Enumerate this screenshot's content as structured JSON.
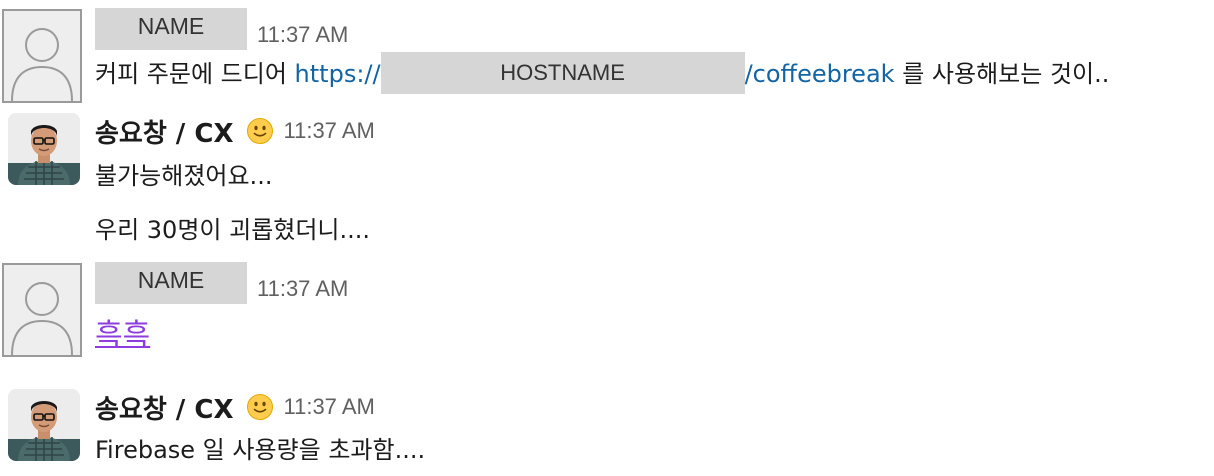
{
  "colors": {
    "link": "#1264a3",
    "mention": "#8e3ce0",
    "timestamp": "#616061",
    "redaction": "#d6d6d6"
  },
  "messages": [
    {
      "avatar": "default-user-icon",
      "sender": "NAME",
      "time": "11:37 AM",
      "text_before": "커피 주문에 드디어",
      "link_prefix": "https://",
      "link_host": "HOSTNAME",
      "link_path": "/coffeebreak",
      "text_after": "를 사용해보는 것이.."
    },
    {
      "avatar": "user-photo",
      "sender": "송요창 / CX",
      "status_emoji": "slightly-smiling-face-icon",
      "time": "11:37 AM",
      "lines": [
        "불가능해졌어요...",
        "우리 30명이 괴롭혔더니...."
      ]
    },
    {
      "avatar": "default-user-icon",
      "sender": "NAME",
      "time": "11:37 AM",
      "text": "흑흑"
    },
    {
      "avatar": "user-photo",
      "sender": "송요창 / CX",
      "status_emoji": "slightly-smiling-face-icon",
      "time": "11:37 AM",
      "text": "Firebase 일 사용량을 초과함...."
    }
  ]
}
